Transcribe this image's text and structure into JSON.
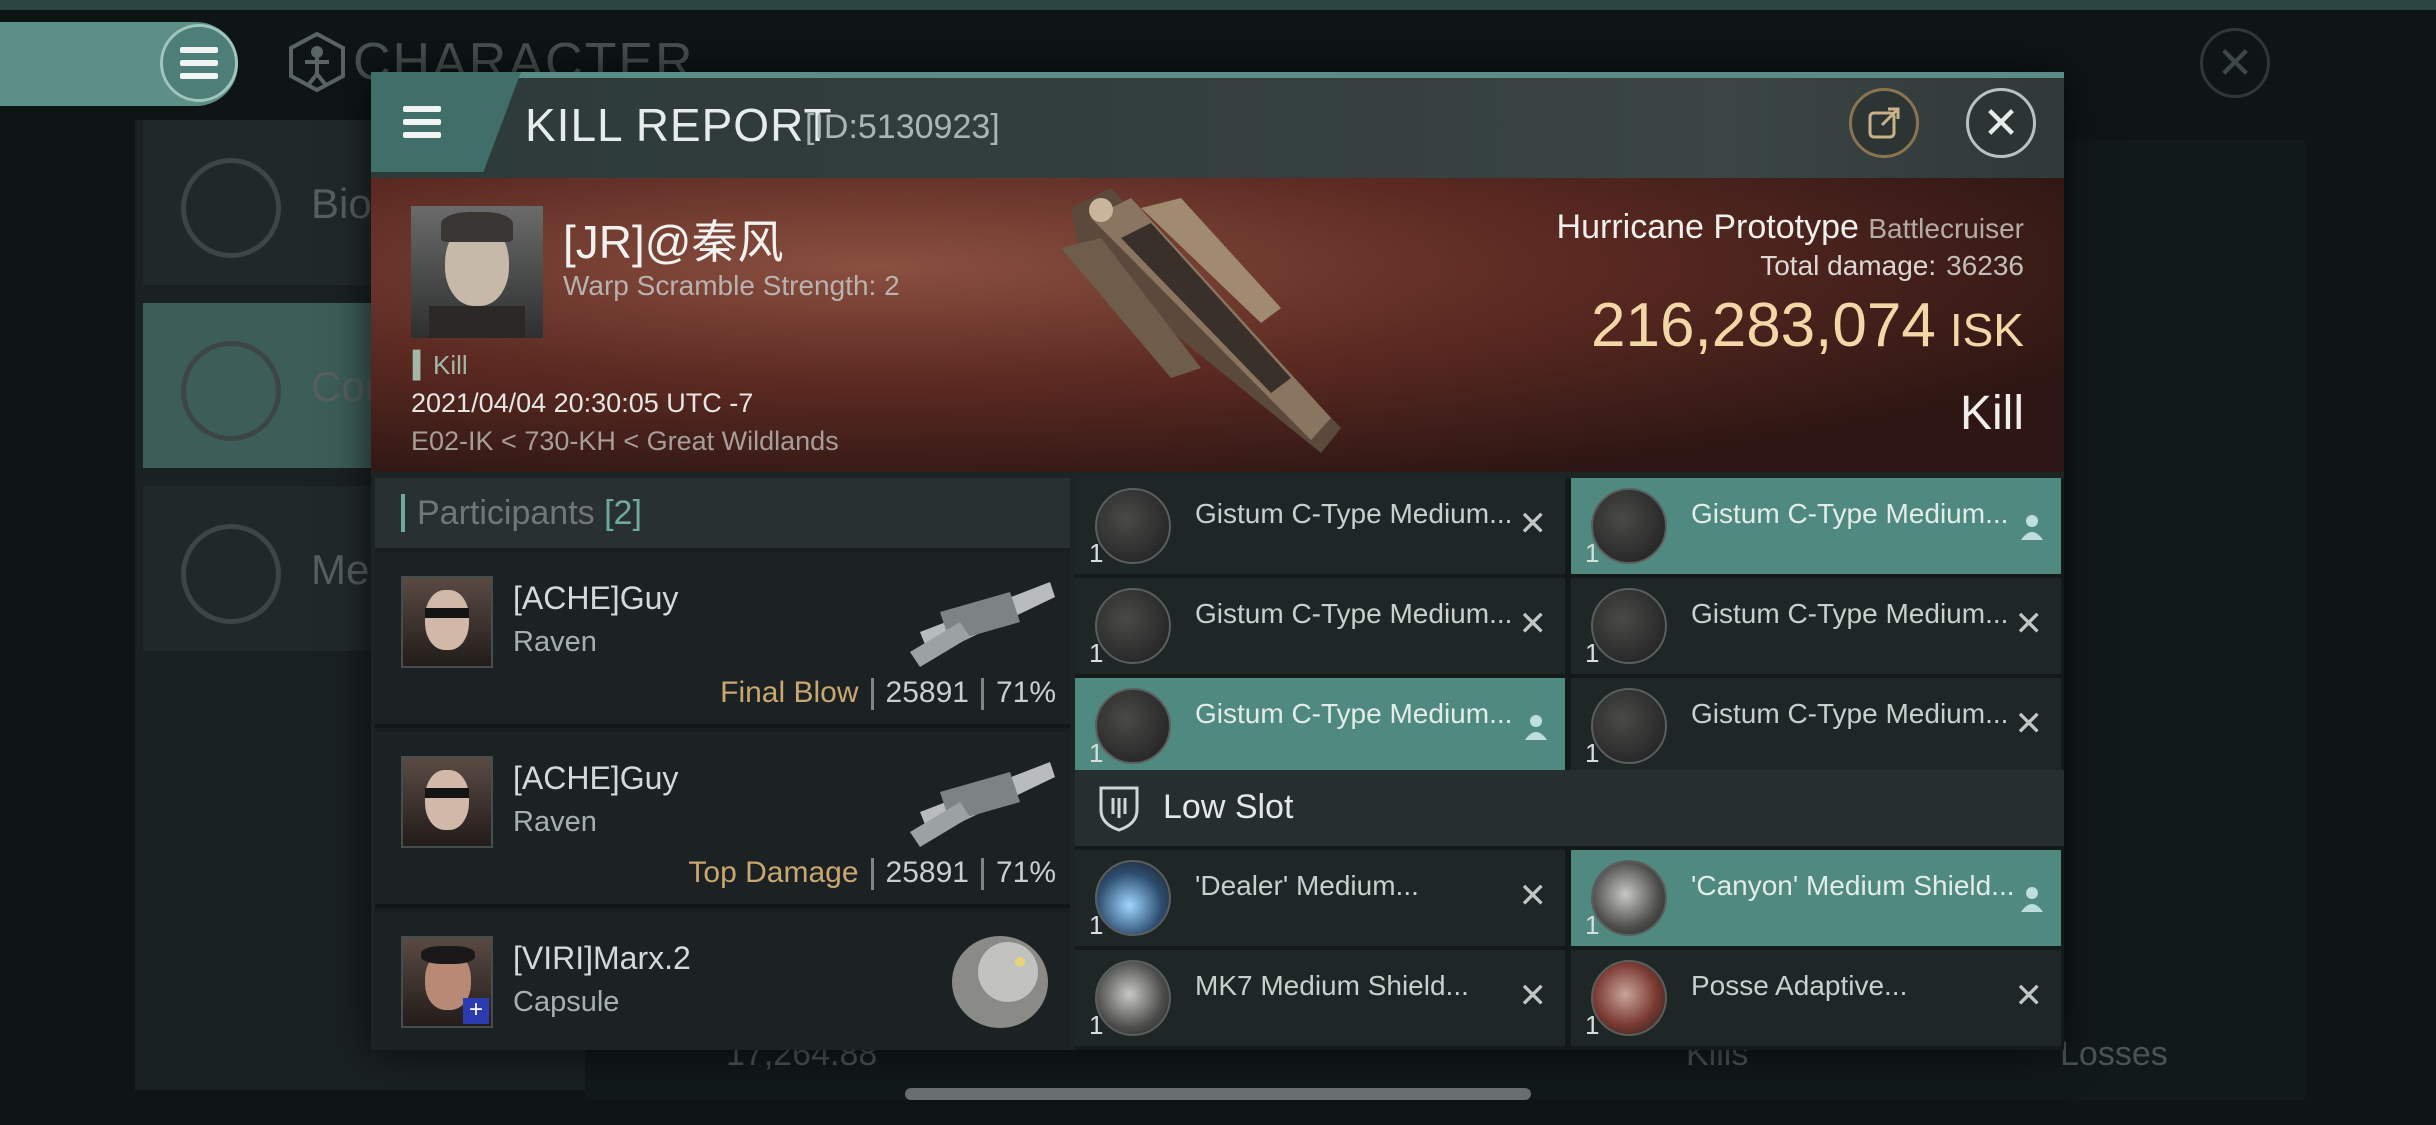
{
  "background": {
    "title": "CHARACTER",
    "nav": [
      {
        "label": "Bio"
      },
      {
        "label": "Con"
      },
      {
        "label": "Med"
      }
    ],
    "bottom": {
      "value": "17,264.88",
      "kills": "Kills",
      "losses": "Losses"
    }
  },
  "modal": {
    "title": "KILL REPORT",
    "id_label": "[ID:5130923]",
    "victim": {
      "name": "[JR]@秦风",
      "warp_scramble": "Warp Scramble Strength: 2",
      "tag": "Kill",
      "timestamp": "2021/04/04 20:30:05 UTC -7",
      "location": "E02-IK < 730-KH < Great Wildlands"
    },
    "ship": {
      "name": "Hurricane Prototype",
      "class": "Battlecruiser",
      "total_damage_label": "Total damage:",
      "total_damage": "36236",
      "isk_value": "216,283,074",
      "isk_unit": "ISK",
      "kill_type": "Kill"
    },
    "participants": {
      "label": "Participants",
      "count": "[2]",
      "rows": [
        {
          "name": "[ACHE]Guy",
          "ship": "Raven",
          "role": "Final Blow",
          "damage": "25891",
          "percent": "71%"
        },
        {
          "name": "[ACHE]Guy",
          "ship": "Raven",
          "role": "Top Damage",
          "damage": "25891",
          "percent": "71%"
        },
        {
          "name": "[VIRI]Marx.2",
          "ship": "Capsule",
          "role": "",
          "damage": "",
          "percent": ""
        }
      ]
    },
    "modules": {
      "mid": [
        {
          "qty": "1",
          "name": "Gistum C-Type Medium...",
          "selected": false
        },
        {
          "qty": "1",
          "name": "Gistum C-Type Medium...",
          "selected": true
        },
        {
          "qty": "1",
          "name": "Gistum C-Type Medium...",
          "selected": false
        },
        {
          "qty": "1",
          "name": "Gistum C-Type Medium...",
          "selected": false
        },
        {
          "qty": "1",
          "name": "Gistum C-Type Medium...",
          "selected": true
        },
        {
          "qty": "1",
          "name": "Gistum C-Type Medium...",
          "selected": false
        }
      ],
      "low_slot_label": "Low Slot",
      "low": [
        {
          "qty": "1",
          "name": "'Dealer' Medium...",
          "selected": false
        },
        {
          "qty": "1",
          "name": "'Canyon' Medium Shield...",
          "selected": true
        },
        {
          "qty": "1",
          "name": "MK7 Medium Shield...",
          "selected": false
        },
        {
          "qty": "1",
          "name": "Posse Adaptive...",
          "selected": false
        }
      ]
    }
  },
  "colors": {
    "accent": "#5a8d86",
    "isk": "#f3d7a6",
    "selected": "#4f8980",
    "role_label": "#c9a770"
  }
}
